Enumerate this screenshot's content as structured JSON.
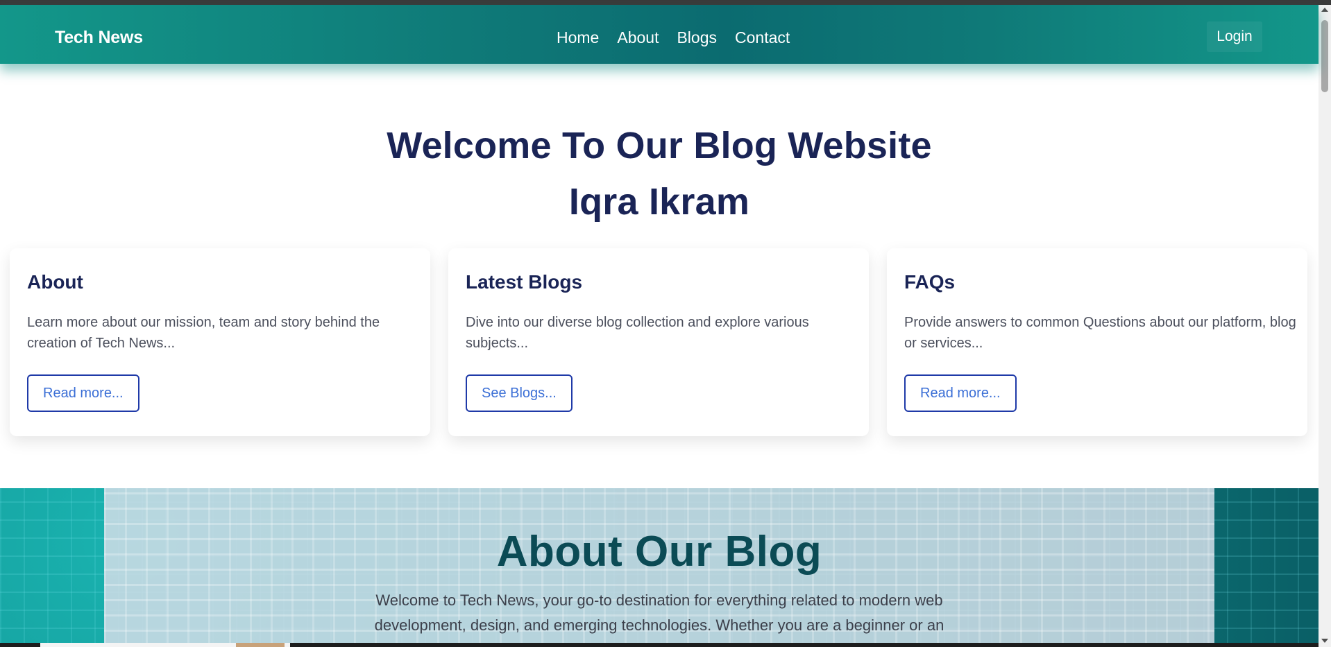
{
  "navbar": {
    "brand": "Tech News",
    "links": [
      "Home",
      "About",
      "Blogs",
      "Contact"
    ],
    "login_label": "Login"
  },
  "hero": {
    "line1": "Welcome To Our Blog Website",
    "line2": "Iqra Ikram"
  },
  "cards": [
    {
      "title": "About",
      "text": "Learn more about our mission, team and story behind the creation of Tech News...",
      "button": "Read more..."
    },
    {
      "title": "Latest Blogs",
      "text": "Dive into our diverse blog collection and explore various subjects...",
      "button": "See Blogs..."
    },
    {
      "title": "FAQs",
      "text": "Provide answers to common Questions about our platform, blog or services...",
      "button": "Read more..."
    }
  ],
  "about": {
    "title": "About Our Blog",
    "text": "Welcome to Tech News, your go-to destination for everything related to modern web development, design, and emerging technologies. Whether you are a beginner or an"
  },
  "colors": {
    "navbar": "#0f7a78",
    "heading": "#1a2456",
    "button_border": "#1f3aa8",
    "button_text": "#3b6fd6",
    "about_title": "#0b4b55"
  }
}
